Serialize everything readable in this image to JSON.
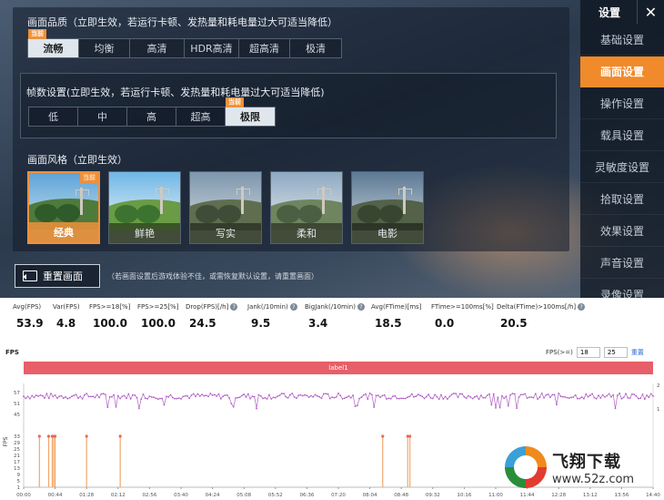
{
  "game_settings": {
    "quality": {
      "title": "画面品质（立即生效，若运行卡顿、发热量和耗电量过大可适当降低）",
      "badge": "当前",
      "options": [
        "流畅",
        "均衡",
        "高清",
        "HDR高清",
        "超高清",
        "极清"
      ],
      "selected": "流畅"
    },
    "fps": {
      "title": "帧数设置(立即生效，若运行卡顿、发热量和耗电量过大可适当降低)",
      "badge": "当前",
      "options": [
        "低",
        "中",
        "高",
        "超高",
        "极限"
      ],
      "selected": "极限"
    },
    "style": {
      "title": "画面风格（立即生效）",
      "badge": "当前",
      "options": [
        "经典",
        "鲜艳",
        "写实",
        "柔和",
        "电影"
      ],
      "selected": "经典"
    },
    "reset_button": "重置画面",
    "reset_note": "（若画面设置后游戏体验不佳，或需恢复默认设置，请重置画面）"
  },
  "sidebar": {
    "title": "设置",
    "close_icon": "close-icon",
    "items": [
      "基础设置",
      "画面设置",
      "操作设置",
      "载具设置",
      "灵敏度设置",
      "拾取设置",
      "效果设置",
      "声音设置",
      "录像设置"
    ],
    "active": "画面设置"
  },
  "stats": [
    {
      "label": "Avg(FPS)",
      "value": "53.9",
      "help": false
    },
    {
      "label": "Var(FPS)",
      "value": "4.8",
      "help": false
    },
    {
      "label": "FPS>=18[%]",
      "value": "100.0",
      "help": false
    },
    {
      "label": "FPS>=25[%]",
      "value": "100.0",
      "help": false
    },
    {
      "label": "Drop(FPS)[/h]",
      "value": "24.5",
      "help": true
    },
    {
      "label": "Jank(/10min)",
      "value": "9.5",
      "help": true
    },
    {
      "label": "BigJank(/10min)",
      "value": "3.4",
      "help": true
    },
    {
      "label": "Avg(FTime)[ms]",
      "value": "18.5",
      "help": false
    },
    {
      "label": "FTime>=100ms[%]",
      "value": "0.0",
      "help": false
    },
    {
      "label": "Delta(FTime)>100ms[/h]",
      "value": "20.5",
      "help": true
    }
  ],
  "chart": {
    "title": "FPS",
    "filter_label": "FPS(>=)",
    "filter_low": "18",
    "filter_high": "25",
    "reset_link": "重置",
    "label_bar": "label1"
  },
  "chart_data": {
    "type": "line",
    "x_ticks": [
      "00:00",
      "00:44",
      "01:28",
      "02:12",
      "02:56",
      "03:40",
      "04:24",
      "05:08",
      "05:52",
      "06:36",
      "07:20",
      "08:04",
      "08:48",
      "09:32",
      "10:16",
      "11:00",
      "11:44",
      "12:28",
      "13:12",
      "13:56",
      "14:40"
    ],
    "y_ticks_fps_upper": [
      57,
      51,
      45
    ],
    "y_ticks_fps_lower": [
      33,
      29,
      25,
      21,
      17,
      13,
      9,
      5,
      1
    ],
    "right_ticks": [
      "2",
      "1"
    ],
    "ylabel": "FPS",
    "duration_seconds": 880,
    "series": [
      {
        "name": "FPS",
        "color": "#b25fc7",
        "baseline": 55,
        "min": 48,
        "max": 58
      },
      {
        "name": "Jank",
        "color": "#f2a76a",
        "events": [
          {
            "t": 22,
            "v": 33
          },
          {
            "t": 35,
            "v": 33
          },
          {
            "t": 40,
            "v": 33
          },
          {
            "t": 42,
            "v": 33
          },
          {
            "t": 44,
            "v": 33
          },
          {
            "t": 88,
            "v": 33
          },
          {
            "t": 135,
            "v": 33
          },
          {
            "t": 502,
            "v": 33
          },
          {
            "t": 537,
            "v": 33
          },
          {
            "t": 540,
            "v": 33
          }
        ]
      }
    ]
  },
  "watermark": {
    "name": "飞翔下载",
    "url": "www.52z.com"
  }
}
